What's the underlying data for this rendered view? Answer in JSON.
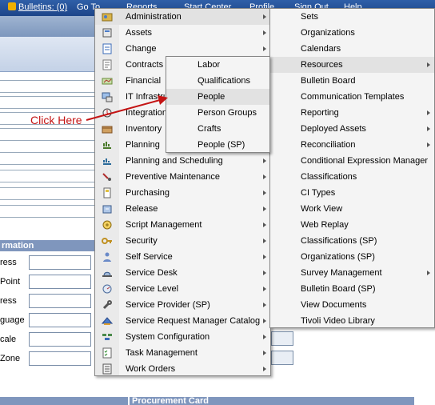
{
  "topbar": {
    "bulletins": "Bulletins: (0)",
    "goto": "Go To",
    "reports": "Reports",
    "start_center": "Start Center",
    "profile": "Profile",
    "sign_out": "Sign Out",
    "help": "Help"
  },
  "background": {
    "section_title": "rmation",
    "field_labels": [
      "ress",
      "Point",
      "ress",
      "guage",
      "cale",
      "Zone"
    ],
    "bottom_right_title": "Procurement Card"
  },
  "goto_menu": {
    "items": [
      {
        "label": "Administration",
        "icon": "admin-icon",
        "submenu": true
      },
      {
        "label": "Assets",
        "icon": "assets-icon",
        "submenu": true
      },
      {
        "label": "Change",
        "icon": "change-icon",
        "submenu": true
      },
      {
        "label": "Contracts",
        "icon": "contracts-icon",
        "submenu": true
      },
      {
        "label": "Financial",
        "icon": "financial-icon",
        "submenu": true
      },
      {
        "label": "IT Infrastructure",
        "icon": "it-infrastructure-icon",
        "submenu": true
      },
      {
        "label": "Integration",
        "icon": "integration-icon",
        "submenu": true
      },
      {
        "label": "Inventory",
        "icon": "inventory-icon",
        "submenu": true
      },
      {
        "label": "Planning",
        "icon": "planning-icon",
        "submenu": true
      },
      {
        "label": "Planning and Scheduling",
        "icon": "scheduling-icon",
        "submenu": true
      },
      {
        "label": "Preventive Maintenance",
        "icon": "pm-icon",
        "submenu": true
      },
      {
        "label": "Purchasing",
        "icon": "purchasing-icon",
        "submenu": true
      },
      {
        "label": "Release",
        "icon": "release-icon",
        "submenu": true
      },
      {
        "label": "Script Management",
        "icon": "script-icon",
        "submenu": true
      },
      {
        "label": "Security",
        "icon": "key-icon",
        "submenu": true
      },
      {
        "label": "Self Service",
        "icon": "self-service-icon",
        "submenu": true
      },
      {
        "label": "Service Desk",
        "icon": "service-desk-icon",
        "submenu": true
      },
      {
        "label": "Service Level",
        "icon": "service-level-icon",
        "submenu": true
      },
      {
        "label": "Service Provider (SP)",
        "icon": "wrench-icon",
        "submenu": true
      },
      {
        "label": "Service Request Manager Catalog",
        "icon": "catalog-icon",
        "submenu": true
      },
      {
        "label": "System Configuration",
        "icon": "config-icon",
        "submenu": true
      },
      {
        "label": "Task Management",
        "icon": "task-icon",
        "submenu": true
      },
      {
        "label": "Work Orders",
        "icon": "work-orders-icon",
        "submenu": true
      }
    ]
  },
  "admin_menu": {
    "items": [
      {
        "label": "Sets",
        "submenu": false
      },
      {
        "label": "Organizations",
        "submenu": false
      },
      {
        "label": "Calendars",
        "submenu": false
      },
      {
        "label": "Resources",
        "submenu": true
      },
      {
        "label": "Bulletin Board",
        "submenu": false
      },
      {
        "label": "Communication Templates",
        "submenu": false
      },
      {
        "label": "Reporting",
        "submenu": true
      },
      {
        "label": "Deployed Assets",
        "submenu": true
      },
      {
        "label": "Reconciliation",
        "submenu": true
      },
      {
        "label": "Conditional Expression Manager",
        "submenu": false
      },
      {
        "label": "Classifications",
        "submenu": false
      },
      {
        "label": "CI Types",
        "submenu": false
      },
      {
        "label": "Work View",
        "submenu": false
      },
      {
        "label": "Web Replay",
        "submenu": false
      },
      {
        "label": "Classifications (SP)",
        "submenu": false
      },
      {
        "label": "Organizations (SP)",
        "submenu": false
      },
      {
        "label": "Survey Management",
        "submenu": true
      },
      {
        "label": "Bulletin Board (SP)",
        "submenu": false
      },
      {
        "label": "View Documents",
        "submenu": false
      },
      {
        "label": "Tivoli Video Library",
        "submenu": false
      }
    ]
  },
  "resources_menu": {
    "items": [
      {
        "label": "Labor"
      },
      {
        "label": "Qualifications"
      },
      {
        "label": "People"
      },
      {
        "label": "Person Groups"
      },
      {
        "label": "Crafts"
      },
      {
        "label": "People (SP)"
      }
    ]
  },
  "annotation": {
    "text": "Click Here",
    "color": "#c41414"
  },
  "colors": {
    "highlight": "#e2e2e2",
    "menu_bg": "#f4f4f4",
    "topbar": "#1d4589"
  }
}
